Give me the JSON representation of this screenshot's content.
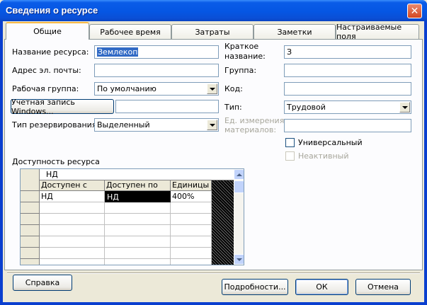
{
  "window": {
    "title": "Сведения о ресурсе",
    "close_glyph": "✕"
  },
  "tabs": [
    {
      "label": "Общие",
      "active": true
    },
    {
      "label": "Рабочее время",
      "active": false
    },
    {
      "label": "Затраты",
      "active": false
    },
    {
      "label": "Заметки",
      "active": false
    },
    {
      "label": "Настраиваемые поля",
      "active": false
    }
  ],
  "form": {
    "resource_name_label": "Название ресурса:",
    "resource_name_value": "Землекоп",
    "email_label": "Адрес эл. почты:",
    "email_value": "",
    "workgroup_label": "Рабочая группа:",
    "workgroup_value": "По умолчанию",
    "windows_account_button": "Учетная запись Windows...",
    "windows_account_value": "",
    "booking_type_label": "Тип резервирования:",
    "booking_type_value": "Выделенный",
    "initials_label_line1": "Краткое",
    "initials_label_line2": "название:",
    "initials_value": "З",
    "group_label": "Группа:",
    "group_value": "",
    "code_label": "Код:",
    "code_value": "",
    "type_label": "Тип:",
    "type_value": "Трудовой",
    "material_label_line1": "Ед. измерения",
    "material_label_line2": "материалов:",
    "material_value": "",
    "generic_label": "Универсальный",
    "generic_checked": false,
    "inactive_label": "Неактивный",
    "inactive_checked": false
  },
  "availability": {
    "section_label": "Доступность ресурса",
    "edit_value": "НД",
    "columns": [
      "Доступен с",
      "Доступен по",
      "Единицы"
    ],
    "rows": [
      {
        "from": "НД",
        "to": "НД",
        "units": "400%"
      }
    ]
  },
  "buttons": {
    "help": "Справка",
    "details": "Подробности...",
    "ok": "ОК",
    "cancel": "Отмена"
  }
}
